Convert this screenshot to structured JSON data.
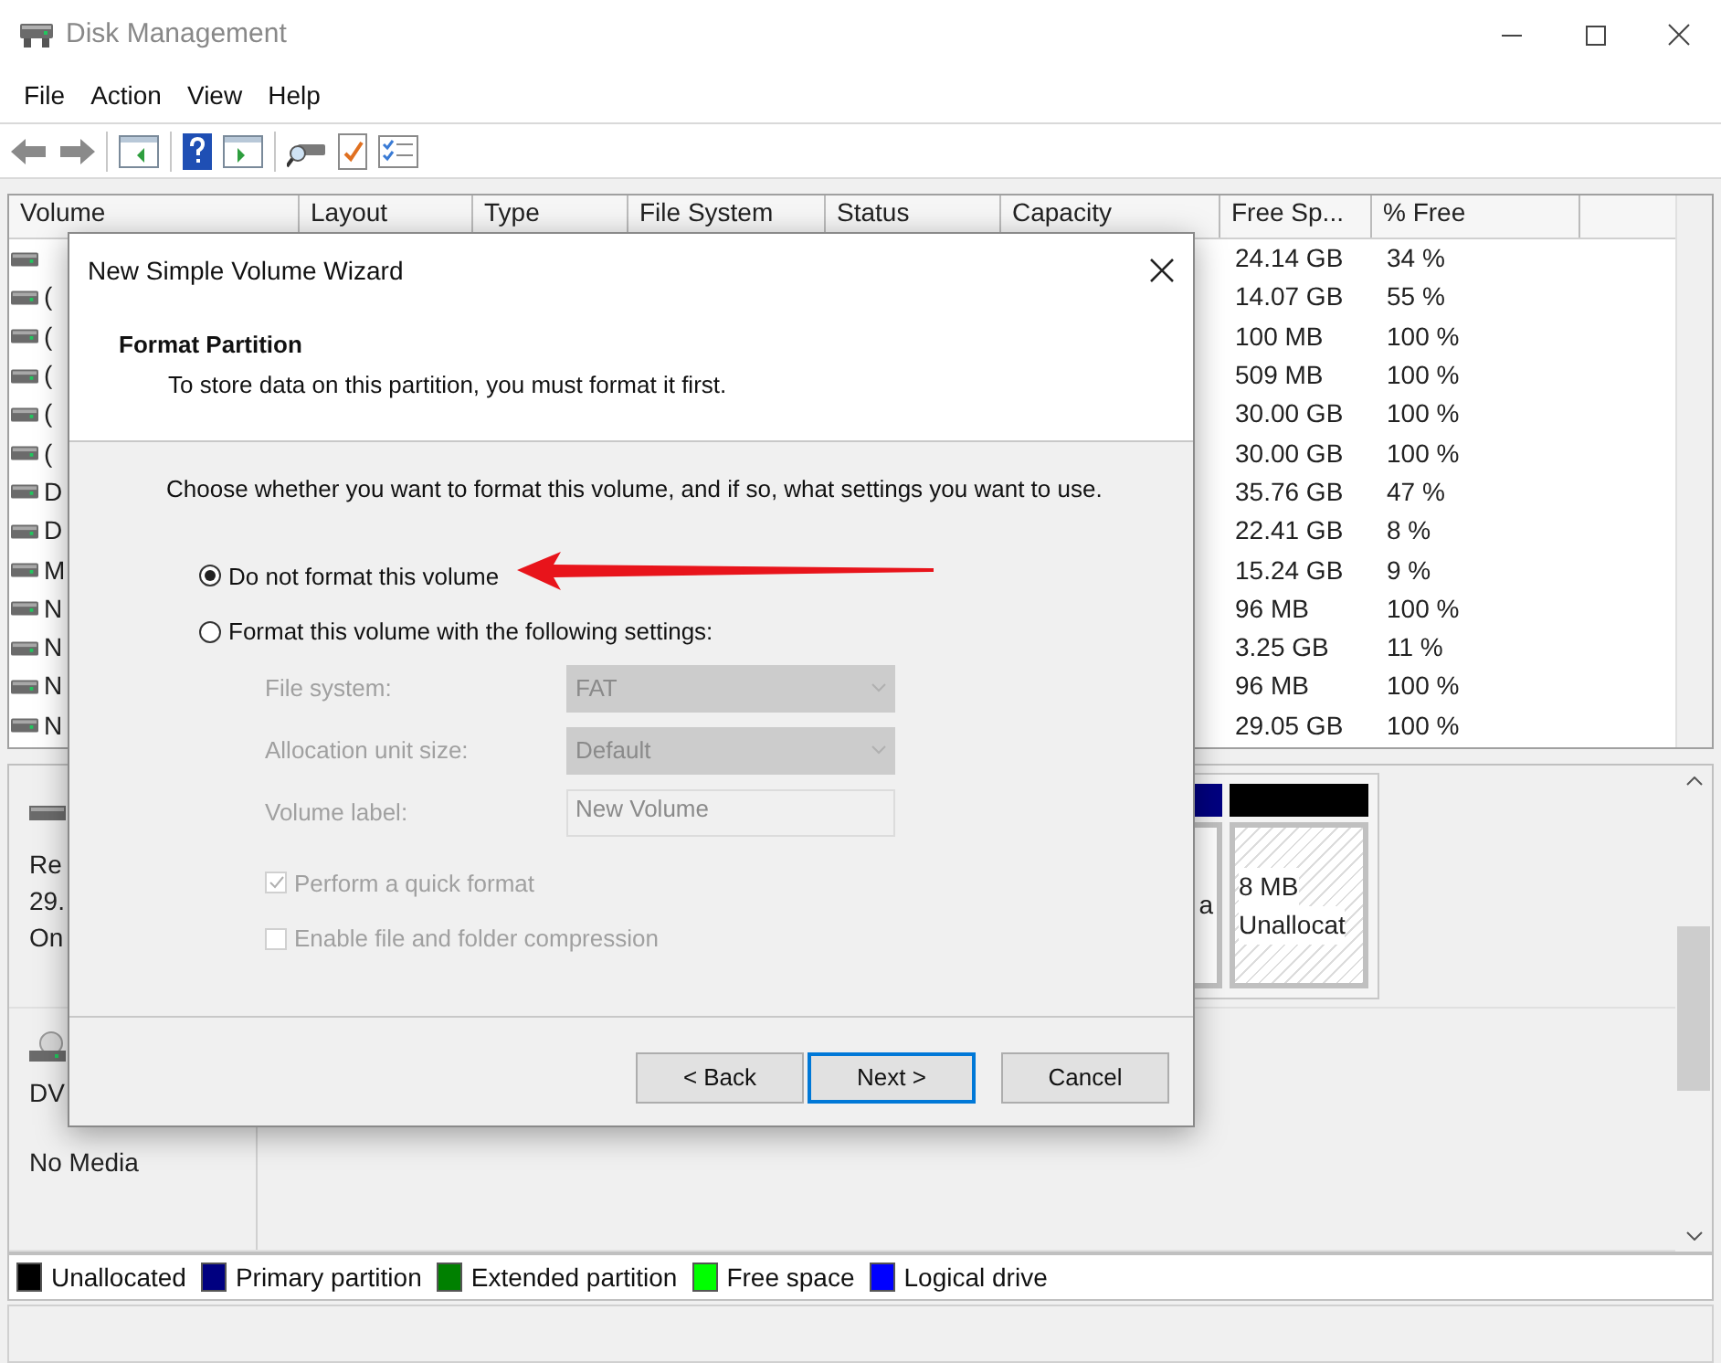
{
  "window": {
    "title": "Disk Management"
  },
  "menu": [
    "File",
    "Action",
    "View",
    "Help"
  ],
  "volume_table": {
    "columns": [
      "Volume",
      "Layout",
      "Type",
      "File System",
      "Status",
      "Capacity",
      "Free Sp...",
      "% Free"
    ],
    "rows": [
      {
        "free_space": "24.14 GB",
        "percent_free": "34 %"
      },
      {
        "volume": "(",
        "free_space": "14.07 GB",
        "percent_free": "55 %"
      },
      {
        "volume": "(",
        "free_space": "100 MB",
        "percent_free": "100 %"
      },
      {
        "volume": "(",
        "free_space": "509 MB",
        "percent_free": "100 %"
      },
      {
        "volume": "(",
        "free_space": "30.00 GB",
        "percent_free": "100 %"
      },
      {
        "volume": "(",
        "free_space": "30.00 GB",
        "percent_free": "100 %"
      },
      {
        "volume": "D",
        "free_space": "35.76 GB",
        "percent_free": "47 %"
      },
      {
        "volume": "D",
        "free_space": "22.41 GB",
        "percent_free": "8 %"
      },
      {
        "volume": "M",
        "free_space": "15.24 GB",
        "percent_free": "9 %"
      },
      {
        "volume": "N",
        "free_space": "96 MB",
        "percent_free": "100 %"
      },
      {
        "volume": "N",
        "free_space": "3.25 GB",
        "percent_free": "11 %"
      },
      {
        "volume": "N",
        "free_space": "96 MB",
        "percent_free": "100 %"
      },
      {
        "volume": "N",
        "free_space": "29.05 GB",
        "percent_free": "100 %"
      }
    ]
  },
  "disks": [
    {
      "kind": "disk",
      "name": "Re",
      "size": "29.",
      "status": "On",
      "partitions": [
        {
          "kind": "primary",
          "color": "#000080",
          "label": "a"
        },
        {
          "kind": "unallocated",
          "color": "#000000",
          "size": "8 MB",
          "label": "Unallocat"
        }
      ]
    },
    {
      "kind": "optical",
      "name": "DV",
      "status": "No Media"
    }
  ],
  "legend": [
    {
      "label": "Unallocated",
      "color": "#000000"
    },
    {
      "label": "Primary partition",
      "color": "#000080"
    },
    {
      "label": "Extended partition",
      "color": "#008000"
    },
    {
      "label": "Free space",
      "color": "#00ff00"
    },
    {
      "label": "Logical drive",
      "color": "#0000ff"
    }
  ],
  "dialog": {
    "title": "New Simple Volume Wizard",
    "heading": "Format Partition",
    "subheading": "To store data on this partition, you must format it first.",
    "intro": "Choose whether you want to format this volume, and if so, what settings you want to use.",
    "options": [
      {
        "label": "Do not format this volume",
        "selected": true
      },
      {
        "label": "Format this volume with the following settings:",
        "selected": false
      }
    ],
    "fields": [
      {
        "kind": "select",
        "label": "File system:",
        "value": "FAT",
        "disabled": true
      },
      {
        "kind": "select",
        "label": "Allocation unit size:",
        "value": "Default",
        "disabled": true
      },
      {
        "kind": "text",
        "label": "Volume label:",
        "value": "New Volume",
        "disabled": true
      }
    ],
    "checkboxes": [
      {
        "label": "Perform a quick format",
        "checked": true,
        "disabled": true
      },
      {
        "label": "Enable file and folder compression",
        "checked": false,
        "disabled": true
      }
    ],
    "buttons": [
      {
        "label": "< Back",
        "focused": false
      },
      {
        "label": "Next >",
        "focused": true
      },
      {
        "label": "Cancel",
        "focused": false
      }
    ]
  }
}
